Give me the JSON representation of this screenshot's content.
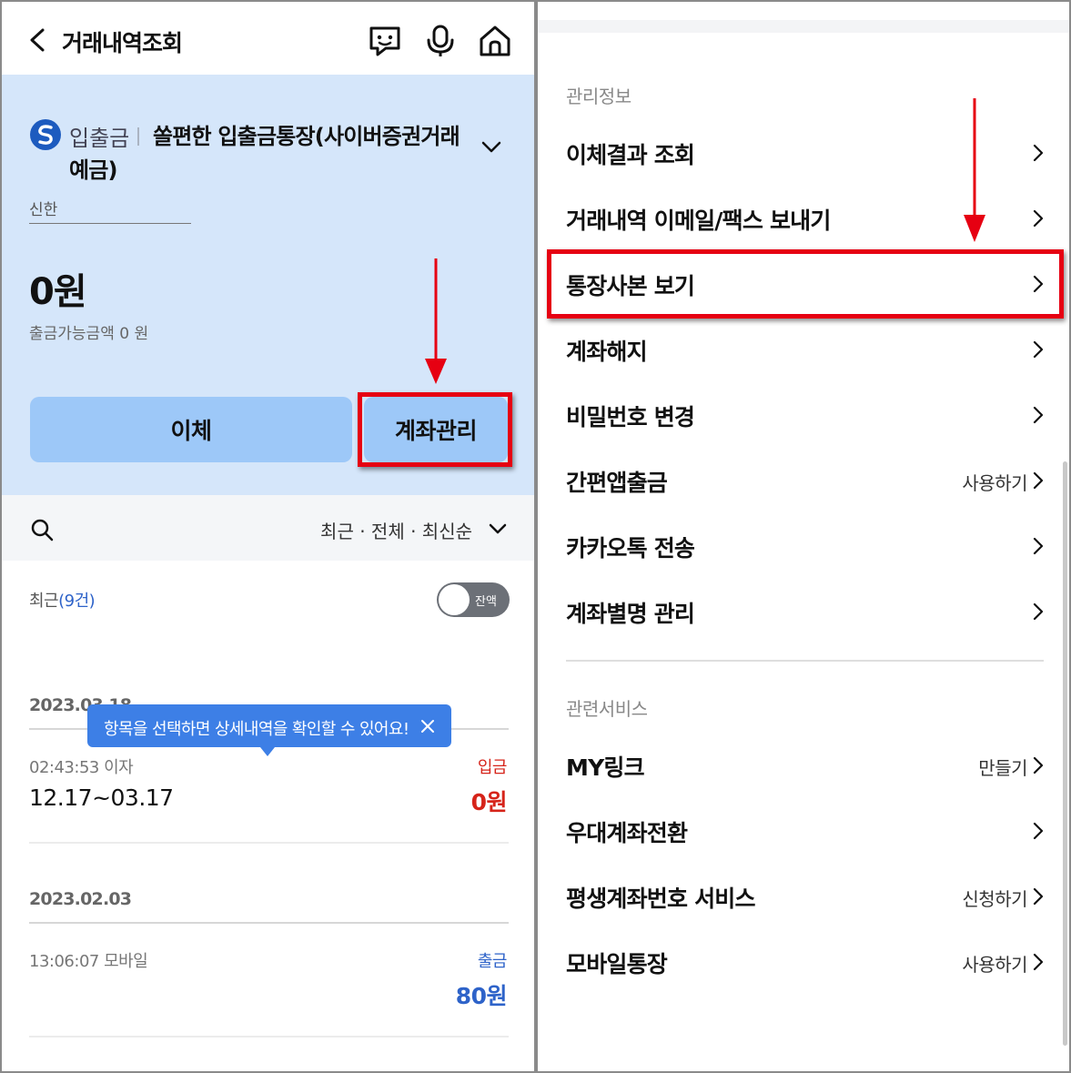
{
  "left": {
    "header": {
      "title": "거래내역조회"
    },
    "account": {
      "type_label": "입출금",
      "name": "쏠편한 입출금통장(사이버증권거래예금)",
      "bank": "신한",
      "balance": "0원",
      "available": "출금가능금액 0 원"
    },
    "buttons": {
      "transfer": "이체",
      "manage": "계좌관리"
    },
    "filter": {
      "text": "최근 · 전체 · 최신순"
    },
    "recent": {
      "label": "최근",
      "count": "(9건)"
    },
    "toggle": {
      "label": "잔액"
    },
    "tooltip": {
      "text": "항목을 선택하면 상세내역을 확인할 수 있어요!"
    },
    "groups": [
      {
        "date": "2023.03.18",
        "tx": {
          "time": "02:43:53 이자",
          "desc": "12.17~03.17",
          "type": "입금",
          "amount": "0원"
        }
      },
      {
        "date": "2023.02.03",
        "tx": {
          "time": "13:06:07 모바일",
          "desc": "",
          "type": "출금",
          "amount": "80원"
        }
      }
    ]
  },
  "right": {
    "sections": [
      {
        "label": "관리정보",
        "items": [
          {
            "label": "이체결과 조회",
            "action": ""
          },
          {
            "label": "거래내역 이메일/팩스 보내기",
            "action": ""
          },
          {
            "label": "통장사본 보기",
            "action": ""
          },
          {
            "label": "계좌해지",
            "action": ""
          },
          {
            "label": "비밀번호 변경",
            "action": ""
          },
          {
            "label": "간편앱출금",
            "action": "사용하기"
          },
          {
            "label": "카카오톡 전송",
            "action": ""
          },
          {
            "label": "계좌별명 관리",
            "action": ""
          }
        ]
      },
      {
        "label": "관련서비스",
        "items": [
          {
            "label": "MY링크",
            "action": "만들기"
          },
          {
            "label": "우대계좌전환",
            "action": ""
          },
          {
            "label": "평생계좌번호 서비스",
            "action": "신청하기"
          },
          {
            "label": "모바일통장",
            "action": "사용하기"
          }
        ]
      }
    ]
  },
  "colors": {
    "accent_blue": "#3d7fe6",
    "account_bg": "#d5e6fa",
    "button_bg": "#9dc8f8",
    "highlight_red": "#e60012",
    "deposit_red": "#d6241a",
    "withdraw_blue": "#2e63c9"
  },
  "icons": [
    "back-arrow-icon",
    "chatbot-icon",
    "microphone-icon",
    "home-icon",
    "shinhan-logo-icon",
    "chevron-down-icon",
    "search-icon",
    "close-icon",
    "chevron-right-icon"
  ]
}
